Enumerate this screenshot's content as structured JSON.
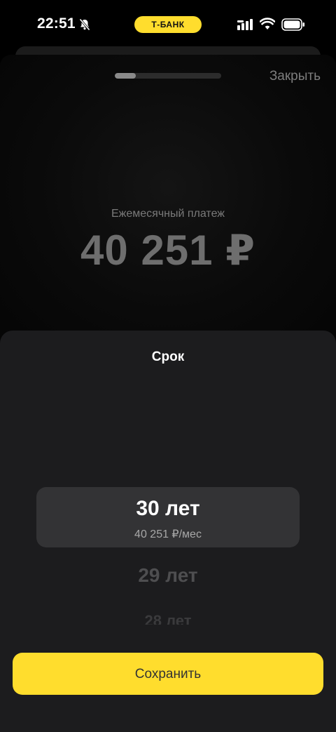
{
  "status_bar": {
    "time": "22:51",
    "brand": "Т-БАНК",
    "icons": [
      "bell-off-icon",
      "signal-icon",
      "wifi-icon",
      "battery-icon"
    ]
  },
  "header": {
    "progress_fraction": 0.2,
    "close_label": "Закрыть"
  },
  "summary": {
    "payment_label": "Ежемесячный платеж",
    "payment_amount": "40 251 ₽"
  },
  "term_sheet": {
    "title": "Срок",
    "selected": {
      "label": "30 лет",
      "sublabel": "40 251 ₽/мес"
    },
    "options": [
      "29 лет",
      "28 лет"
    ],
    "save_label": "Сохранить"
  },
  "colors": {
    "accent": "#ffdd2d",
    "sheet_bg": "#1c1c1e",
    "selected_bg": "#333335"
  }
}
